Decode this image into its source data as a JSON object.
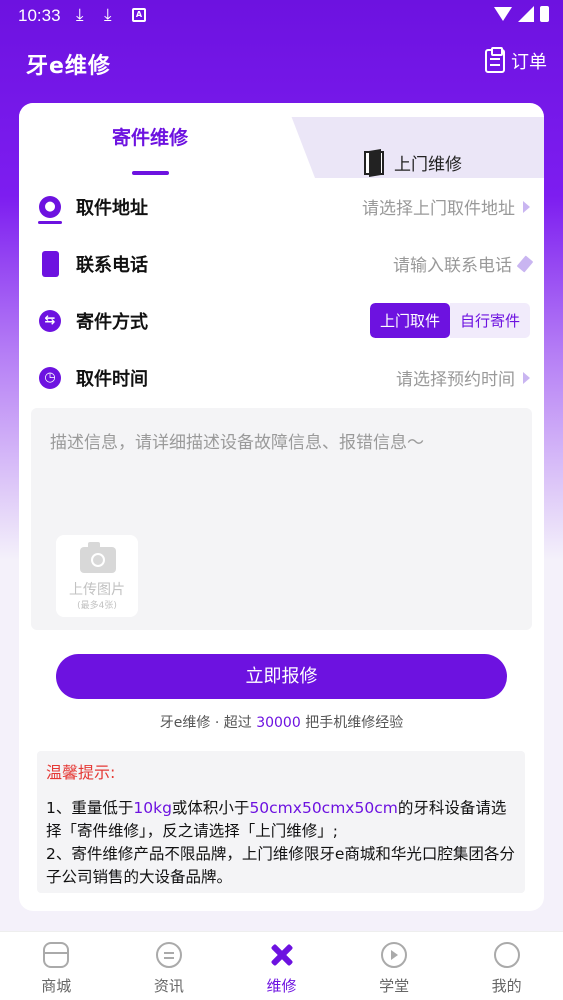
{
  "status_bar": {
    "time": "10:33",
    "download_icons": [
      "⤓",
      "⤓"
    ],
    "nfc": "A"
  },
  "app": {
    "title": "牙e维修",
    "orders_label": "订单"
  },
  "tabs": {
    "mail_in": "寄件维修",
    "on_site": "上门维修",
    "active": "mail_in"
  },
  "form": {
    "address": {
      "label": "取件地址",
      "value": "请选择上门取件地址"
    },
    "phone": {
      "label": "联系电话",
      "placeholder": "请输入联系电话"
    },
    "method": {
      "label": "寄件方式",
      "options": [
        "上门取件",
        "自行寄件"
      ],
      "selected": "上门取件"
    },
    "time": {
      "label": "取件时间",
      "value": "请选择预约时间"
    }
  },
  "description": {
    "placeholder": "描述信息，请详细描述设备故障信息、报错信息～",
    "upload_label": "上传图片",
    "upload_hint": "(最多4张)"
  },
  "submit_label": "立即报修",
  "slogan": {
    "prefix": "牙e维修 · 超过 ",
    "number": "30000",
    "suffix": " 把手机维修经验"
  },
  "tips": {
    "title": "温馨提示:",
    "line1_a": "1、重量低于",
    "line1_b": "10kg",
    "line1_c": "或体积小于",
    "line1_d": "50cmx50cmx50cm",
    "line1_e": "的牙科设备请选择「寄件维修」，反之请选择「上门维修」;",
    "line2": "2、寄件维修产品不限品牌，上门维修限牙e商城和华光口腔集团各分子公司销售的大设备品牌。"
  },
  "bottom_nav": [
    {
      "label": "商城",
      "icon": "store-icon"
    },
    {
      "label": "资讯",
      "icon": "news-icon"
    },
    {
      "label": "维修",
      "icon": "repair-tools-icon",
      "active": true
    },
    {
      "label": "学堂",
      "icon": "video-class-icon"
    },
    {
      "label": "我的",
      "icon": "profile-icon"
    }
  ],
  "colors": {
    "brand": "#6d12e0",
    "warning": "#e53935"
  }
}
